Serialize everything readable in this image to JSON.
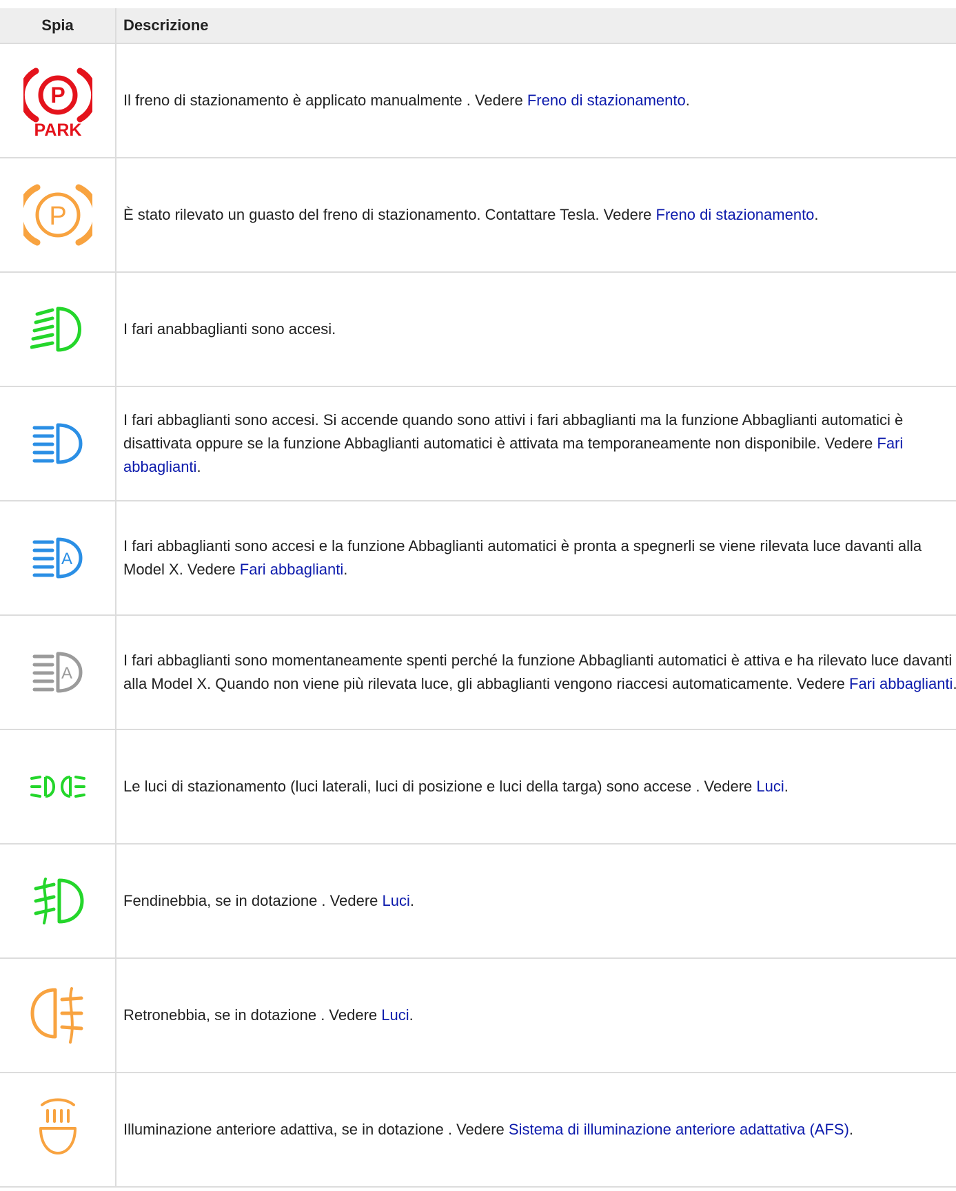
{
  "header": {
    "col_icon": "Spia",
    "col_desc": "Descrizione"
  },
  "colors": {
    "red": "#e4131c",
    "orange": "#f8a340",
    "green": "#24d62b",
    "blue": "#2b8fe5",
    "gray": "#9b9b9b",
    "link": "#0d1bac"
  },
  "rows": [
    {
      "icon": "parking-brake-red-icon",
      "icon_text": "PARK",
      "text": "Il freno di stazionamento è applicato manualmente . Vedere ",
      "link": "Freno di stazionamento",
      "after": "."
    },
    {
      "icon": "parking-brake-fault-orange-icon",
      "text": "È stato rilevato un guasto del freno di stazionamento. Contattare Tesla. Vedere ",
      "link": "Freno di stazionamento",
      "after": "."
    },
    {
      "icon": "low-beam-green-icon",
      "text": "I fari anabbaglianti sono accesi.",
      "link": "",
      "after": ""
    },
    {
      "icon": "high-beam-blue-icon",
      "text": "I fari abbaglianti sono accesi. Si accende quando sono attivi i fari abbaglianti ma la funzione Abbaglianti automatici è disattivata oppure se la funzione Abbaglianti automatici è attivata ma temporaneamente non disponibile. Vedere ",
      "link": "Fari abbaglianti",
      "after": "."
    },
    {
      "icon": "auto-high-beam-blue-icon",
      "text": "I fari abbaglianti sono accesi e la funzione Abbaglianti automatici è pronta a spegnerli se viene rilevata luce davanti alla Model X. Vedere ",
      "link": "Fari abbaglianti",
      "after": "."
    },
    {
      "icon": "auto-high-beam-gray-icon",
      "text": "I fari abbaglianti sono momentaneamente spenti perché la funzione Abbaglianti automatici è attiva e ha rilevato luce davanti alla Model X. Quando non viene più rilevata luce, gli abbaglianti vengono riaccesi automaticamente. Vedere ",
      "link": "Fari abbaglianti",
      "after": "."
    },
    {
      "icon": "parking-lights-green-icon",
      "text": "Le luci di stazionamento (luci laterali, luci di posizione e luci della targa) sono accese . Vedere ",
      "link": "Luci",
      "after": "."
    },
    {
      "icon": "front-fog-light-green-icon",
      "text": "Fendinebbia, se in dotazione . Vedere ",
      "link": "Luci",
      "after": "."
    },
    {
      "icon": "rear-fog-light-orange-icon",
      "text": "Retronebbia, se in dotazione . Vedere ",
      "link": "Luci",
      "after": "."
    },
    {
      "icon": "adaptive-front-lighting-orange-icon",
      "text": "Illuminazione anteriore adattiva, se in dotazione . Vedere ",
      "link": "Sistema di illuminazione anteriore adattativa (AFS)",
      "after": "."
    }
  ]
}
